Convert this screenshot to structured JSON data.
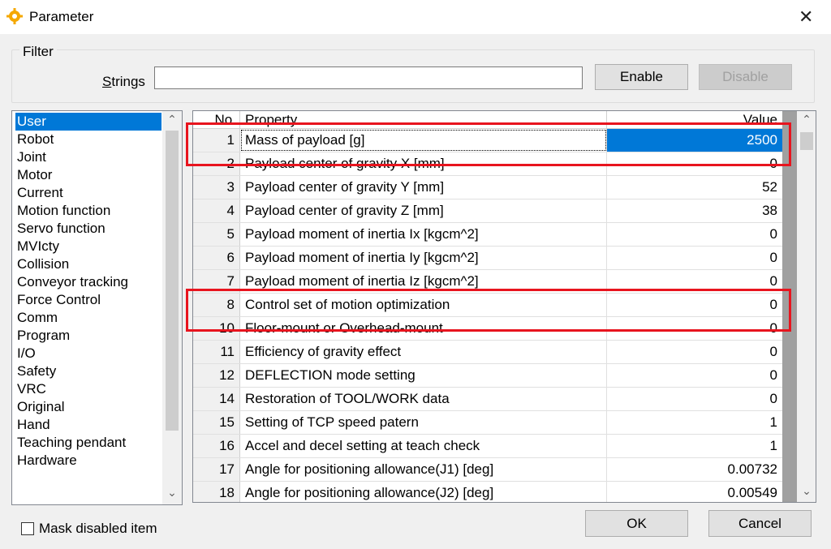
{
  "window": {
    "title": "Parameter"
  },
  "filter": {
    "group_label": "Filter",
    "strings_label_prefix": "S",
    "strings_label_rest": "trings",
    "strings_value": "",
    "enable_label": "Enable",
    "disable_label": "Disable"
  },
  "categories": {
    "items": [
      "User",
      "Robot",
      "Joint",
      "Motor",
      "Current",
      "Motion function",
      "Servo function",
      "MVIcty",
      "Collision",
      "Conveyor tracking",
      "Force Control",
      "Comm",
      "Program",
      "I/O",
      "Safety",
      "VRC",
      "Original",
      "Hand",
      "Teaching pendant",
      "Hardware"
    ],
    "selected": "User"
  },
  "grid": {
    "headers": {
      "no": "No.",
      "property": "Property",
      "value": "Value"
    },
    "rows": [
      {
        "no": "1",
        "property": "Mass of payload [g]",
        "value": "2500"
      },
      {
        "no": "2",
        "property": "Payload center of gravity X [mm]",
        "value": "0"
      },
      {
        "no": "3",
        "property": "Payload center of gravity Y [mm]",
        "value": "52"
      },
      {
        "no": "4",
        "property": "Payload center of gravity Z [mm]",
        "value": "38"
      },
      {
        "no": "5",
        "property": "Payload moment of inertia Ix [kgcm^2]",
        "value": "0"
      },
      {
        "no": "6",
        "property": "Payload moment of inertia Iy [kgcm^2]",
        "value": "0"
      },
      {
        "no": "7",
        "property": "Payload moment of inertia Iz [kgcm^2]",
        "value": "0"
      },
      {
        "no": "8",
        "property": "Control set of motion optimization",
        "value": "0"
      },
      {
        "no": "10",
        "property": "Floor-mount or Overhead-mount",
        "value": "0"
      },
      {
        "no": "11",
        "property": "Efficiency of gravity effect",
        "value": "0"
      },
      {
        "no": "12",
        "property": "DEFLECTION mode setting",
        "value": "0"
      },
      {
        "no": "14",
        "property": "Restoration of TOOL/WORK data",
        "value": "0"
      },
      {
        "no": "15",
        "property": "Setting of TCP speed patern",
        "value": "1"
      },
      {
        "no": "16",
        "property": "Accel and decel setting at teach check",
        "value": "1"
      },
      {
        "no": "17",
        "property": "Angle for positioning allowance(J1) [deg]",
        "value": "0.00732"
      },
      {
        "no": "18",
        "property": "Angle for positioning allowance(J2) [deg]",
        "value": "0.00549"
      }
    ],
    "active_row": 0
  },
  "footer": {
    "mask_label": "Mask disabled item",
    "mask_checked": false,
    "ok_label": "OK",
    "cancel_label": "Cancel"
  },
  "colors": {
    "selection": "#0078d7",
    "highlight_box": "#e8141e"
  }
}
